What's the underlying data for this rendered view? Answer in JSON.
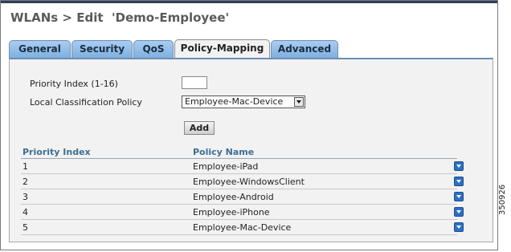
{
  "title": "WLANs > Edit  'Demo-Employee'",
  "tabs": [
    "General",
    "Security",
    "QoS",
    "Policy-Mapping",
    "Advanced"
  ],
  "active_tab": "Policy-Mapping",
  "form": {
    "priority_label": "Priority Index (1-16)",
    "priority_value": "",
    "policy_label": "Local Classification Policy",
    "policy_selected": "Employee-Mac-Device",
    "add_label": "Add"
  },
  "table": {
    "headers": [
      "Priority Index",
      "Policy Name"
    ],
    "rows": [
      {
        "index": "1",
        "policy": "Employee-iPad"
      },
      {
        "index": "2",
        "policy": "Employee-WindowsClient"
      },
      {
        "index": "3",
        "policy": "Employee-Android"
      },
      {
        "index": "4",
        "policy": "Employee-iPhone"
      },
      {
        "index": "5",
        "policy": "Employee-Mac-Device"
      }
    ]
  },
  "figure_id": "350926"
}
